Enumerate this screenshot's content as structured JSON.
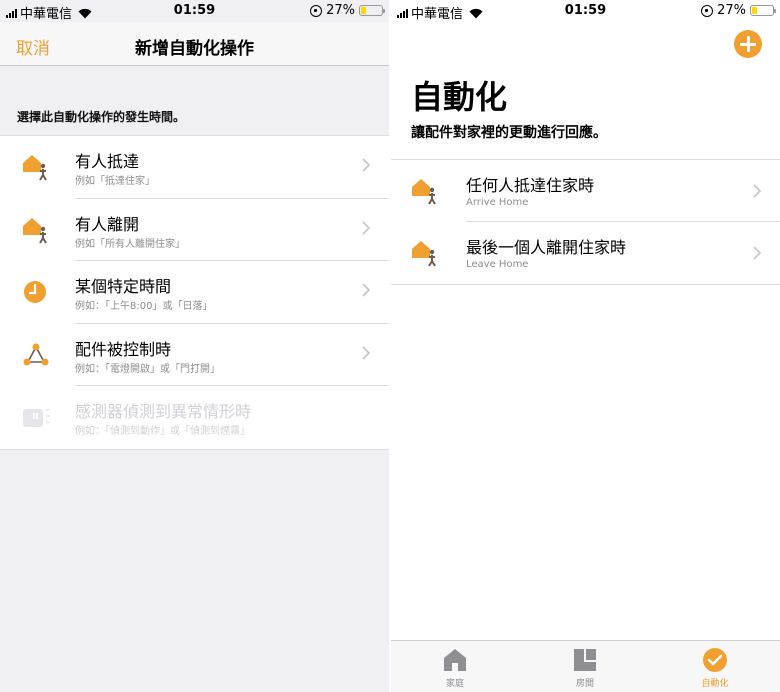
{
  "status_left": {
    "carrier": "中華電信",
    "time": "01:59",
    "battery": "27%",
    "battery_level": 0.27
  },
  "status_right": {
    "carrier": "中華電信",
    "time": "01:59",
    "battery": "27%",
    "battery_level": 0.27
  },
  "left": {
    "nav": {
      "cancel": "取消",
      "title": "新增自動化操作"
    },
    "section_label": "選擇此自動化操作的發生時間。",
    "rows": [
      {
        "title": "有人抵達",
        "subtitle": "例如「抵達住家」",
        "icon": "house-person-icon",
        "enabled": true
      },
      {
        "title": "有人離開",
        "subtitle": "例如「所有人離開住家」",
        "icon": "house-person-icon",
        "enabled": true
      },
      {
        "title": "某個特定時間",
        "subtitle": "例如：「上午8:00」或「日落」",
        "icon": "clock-icon",
        "enabled": true
      },
      {
        "title": "配件被控制時",
        "subtitle": "例如：「電燈開啟」或「門打開」",
        "icon": "accessory-network-icon",
        "enabled": true
      },
      {
        "title": "感測器偵測到異常情形時",
        "subtitle": "例如：「偵測到動作」或「偵測到煙霧」",
        "icon": "sensor-icon",
        "enabled": false
      }
    ]
  },
  "right": {
    "title": "自動化",
    "subtitle": "讓配件對家裡的更動進行回應。",
    "rows": [
      {
        "title": "任何人抵達住家時",
        "subtitle": "Arrive Home",
        "icon": "house-person-icon"
      },
      {
        "title": "最後一個人離開住家時",
        "subtitle": "Leave Home",
        "icon": "house-person-icon"
      }
    ],
    "tabs": [
      {
        "label": "家庭",
        "icon": "home-icon",
        "active": false
      },
      {
        "label": "房間",
        "icon": "rooms-icon",
        "active": false
      },
      {
        "label": "自動化",
        "icon": "automation-icon",
        "active": true
      }
    ]
  },
  "colors": {
    "accent": "#f0a030",
    "person": "#6e5c4e",
    "disabled": "#d1d1d6"
  }
}
